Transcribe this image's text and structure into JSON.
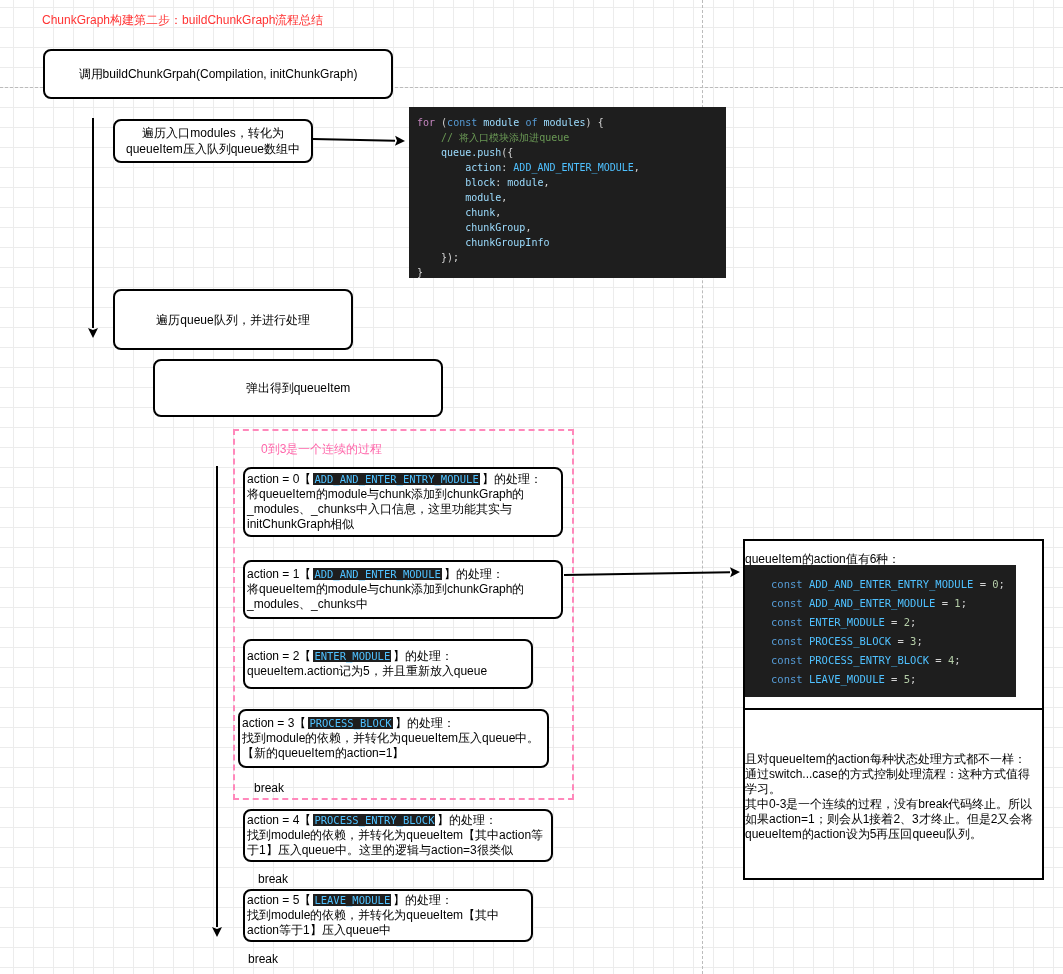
{
  "title": "ChunkGraph构建第二步：buildChunkGraph流程总结",
  "steps": [
    {
      "text": "调用buildChunkGrpah(Compilation, initChunkGraph)"
    },
    {
      "text": "遍历入口modules，转化为queueItem压入队列queue数组中"
    },
    {
      "text": "遍历queue队列，并进行处理"
    },
    {
      "text": "弹出得到queueItem"
    }
  ],
  "code_snippet": {
    "lines": [
      [
        {
          "kind": "keyword",
          "text": "for"
        },
        {
          "kind": "punct",
          "text": " ("
        },
        {
          "kind": "storage",
          "text": "const"
        },
        {
          "kind": "var",
          "text": " module "
        },
        {
          "kind": "storage",
          "text": "of"
        },
        {
          "kind": "var",
          "text": " modules"
        },
        {
          "kind": "punct",
          "text": ") {"
        }
      ],
      [
        {
          "kind": "comment",
          "text": "    // 将入口模块添加进queue"
        }
      ],
      [
        {
          "kind": "var",
          "text": "    queue.push"
        },
        {
          "kind": "punct",
          "text": "({"
        }
      ],
      [
        {
          "kind": "var",
          "text": "        action"
        },
        {
          "kind": "punct",
          "text": ": "
        },
        {
          "kind": "constant",
          "text": "ADD_AND_ENTER_MODULE"
        },
        {
          "kind": "punct",
          "text": ","
        }
      ],
      [
        {
          "kind": "var",
          "text": "        block"
        },
        {
          "kind": "punct",
          "text": ": "
        },
        {
          "kind": "var",
          "text": "module"
        },
        {
          "kind": "punct",
          "text": ","
        }
      ],
      [
        {
          "kind": "var",
          "text": "        module"
        },
        {
          "kind": "punct",
          "text": ","
        }
      ],
      [
        {
          "kind": "var",
          "text": "        chunk"
        },
        {
          "kind": "punct",
          "text": ","
        }
      ],
      [
        {
          "kind": "var",
          "text": "        chunkGroup"
        },
        {
          "kind": "punct",
          "text": ","
        }
      ],
      [
        {
          "kind": "var",
          "text": "        chunkGroupInfo"
        }
      ],
      [
        {
          "kind": "punct",
          "text": "    });"
        }
      ],
      [
        {
          "kind": "punct",
          "text": "}"
        }
      ]
    ]
  },
  "group": {
    "label": "0到3是一个连续的过程"
  },
  "actions": [
    {
      "prefix": "action = 0【",
      "constant": "ADD_AND_ENTER_ENTRY_MODULE",
      "suffix": "】的处理：",
      "description": "将queueItem的module与chunk添加到chunkGraph的_modules、_chunks中入口信息，这里功能其实与initChunkGraph相似"
    },
    {
      "prefix": "action = 1【",
      "constant": "ADD_AND_ENTER_MODULE",
      "suffix": "】的处理：",
      "description": "将queueItem的module与chunk添加到chunkGraph的_modules、_chunks中"
    },
    {
      "prefix": "action = 2【",
      "constant": "ENTER_MODULE",
      "suffix": "】的处理：",
      "description": "queueItem.action记为5，并且重新放入queue"
    },
    {
      "prefix": "action = 3【",
      "constant": "PROCESS_BLOCK",
      "suffix": "】的处理：",
      "description": "找到module的依赖，并转化为queueItem压入queue中。【新的queueItem的action=1】"
    },
    {
      "prefix": "action = 4【",
      "constant": "PROCESS_ENTRY_BLOCK",
      "suffix": "】的处理：",
      "description": "找到module的依赖，并转化为queueItem【其中action等于1】压入queue中。这里的逻辑与action=3很类似"
    },
    {
      "prefix": "action = 5【",
      "constant": "LEAVE_MODULE",
      "suffix": "】的处理：",
      "description": "找到module的依赖，并转化为queueItem【其中action等于1】压入queue中"
    }
  ],
  "break_labels": [
    "break",
    "break",
    "break"
  ],
  "note": {
    "heading": "queueItem的action值有6种：",
    "constants": [
      [
        {
          "kind": "storage",
          "text": "const "
        },
        {
          "kind": "constant",
          "text": "ADD_AND_ENTER_ENTRY_MODULE"
        },
        {
          "kind": "punct",
          "text": " = "
        },
        {
          "kind": "number",
          "text": "0"
        },
        {
          "kind": "punct",
          "text": ";"
        }
      ],
      [
        {
          "kind": "storage",
          "text": "const "
        },
        {
          "kind": "constant",
          "text": "ADD_AND_ENTER_MODULE"
        },
        {
          "kind": "punct",
          "text": " = "
        },
        {
          "kind": "number",
          "text": "1"
        },
        {
          "kind": "punct",
          "text": ";"
        }
      ],
      [
        {
          "kind": "storage",
          "text": "const "
        },
        {
          "kind": "constant",
          "text": "ENTER_MODULE"
        },
        {
          "kind": "punct",
          "text": " = "
        },
        {
          "kind": "number",
          "text": "2"
        },
        {
          "kind": "punct",
          "text": ";"
        }
      ],
      [
        {
          "kind": "storage",
          "text": "const "
        },
        {
          "kind": "constant",
          "text": "PROCESS_BLOCK"
        },
        {
          "kind": "punct",
          "text": " = "
        },
        {
          "kind": "number",
          "text": "3"
        },
        {
          "kind": "punct",
          "text": ";"
        }
      ],
      [
        {
          "kind": "storage",
          "text": "const "
        },
        {
          "kind": "constant",
          "text": "PROCESS_ENTRY_BLOCK"
        },
        {
          "kind": "punct",
          "text": " = "
        },
        {
          "kind": "number",
          "text": "4"
        },
        {
          "kind": "punct",
          "text": ";"
        }
      ],
      [
        {
          "kind": "storage",
          "text": "const "
        },
        {
          "kind": "constant",
          "text": "LEAVE_MODULE"
        },
        {
          "kind": "punct",
          "text": " = "
        },
        {
          "kind": "number",
          "text": "5"
        },
        {
          "kind": "punct",
          "text": ";"
        }
      ]
    ],
    "paragraphs": [
      "且对queueItem的action每种状态处理方式都不一样：",
      "通过switch...case的方式控制处理流程：这种方式值得学习。",
      "其中0-3是一个连续的过程，没有break代码终止。所以如果action=1；则会从1接着2、3才终止。但是2又会将queueItem的action设为5再压回queeu队列。"
    ]
  }
}
